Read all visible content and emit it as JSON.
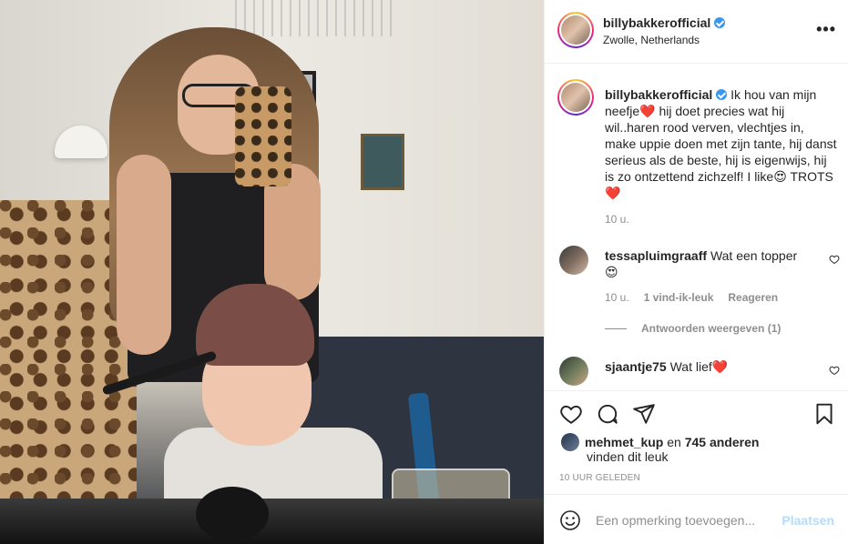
{
  "post": {
    "username": "billybakkerofficial",
    "location": "Zwolle, Netherlands",
    "more_icon": "•••"
  },
  "caption": {
    "username": "billybakkerofficial",
    "text_part1": "Ik hou van mijn neefje",
    "heart1": "❤️",
    "text_part2": " hij doet precies wat hij wil..haren rood verven, vlechtjes in, make uppie doen met zijn tante, hij danst serieus als de beste, hij is eigenwijs, hij is zo ontzettend zichzelf! I like",
    "emoji_love": "😍",
    "text_part3": " TROTS",
    "heart2": "❤️",
    "time": "10 u."
  },
  "comments": [
    {
      "username": "tessapluimgraaff",
      "text": "Wat een topper",
      "emoji": "😍",
      "time": "10 u.",
      "likes": "1 vind-ik-leuk",
      "reply": "Reageren",
      "view_replies": "Antwoorden weergeven (1)"
    },
    {
      "username": "sjaantje75",
      "text": "Wat lief",
      "emoji": "❤️"
    }
  ],
  "likes": {
    "user": "mehmet_kup",
    "connector": " en ",
    "others": "745 anderen",
    "suffix": "vinden dit leuk"
  },
  "timestamp": "10 UUR GELEDEN",
  "comment_box": {
    "placeholder": "Een opmerking toevoegen...",
    "post_label": "Plaatsen"
  },
  "colors": {
    "verified": "#3897f0",
    "secondary_text": "#8e8e8e",
    "post_button_disabled": "#b3dbff"
  }
}
